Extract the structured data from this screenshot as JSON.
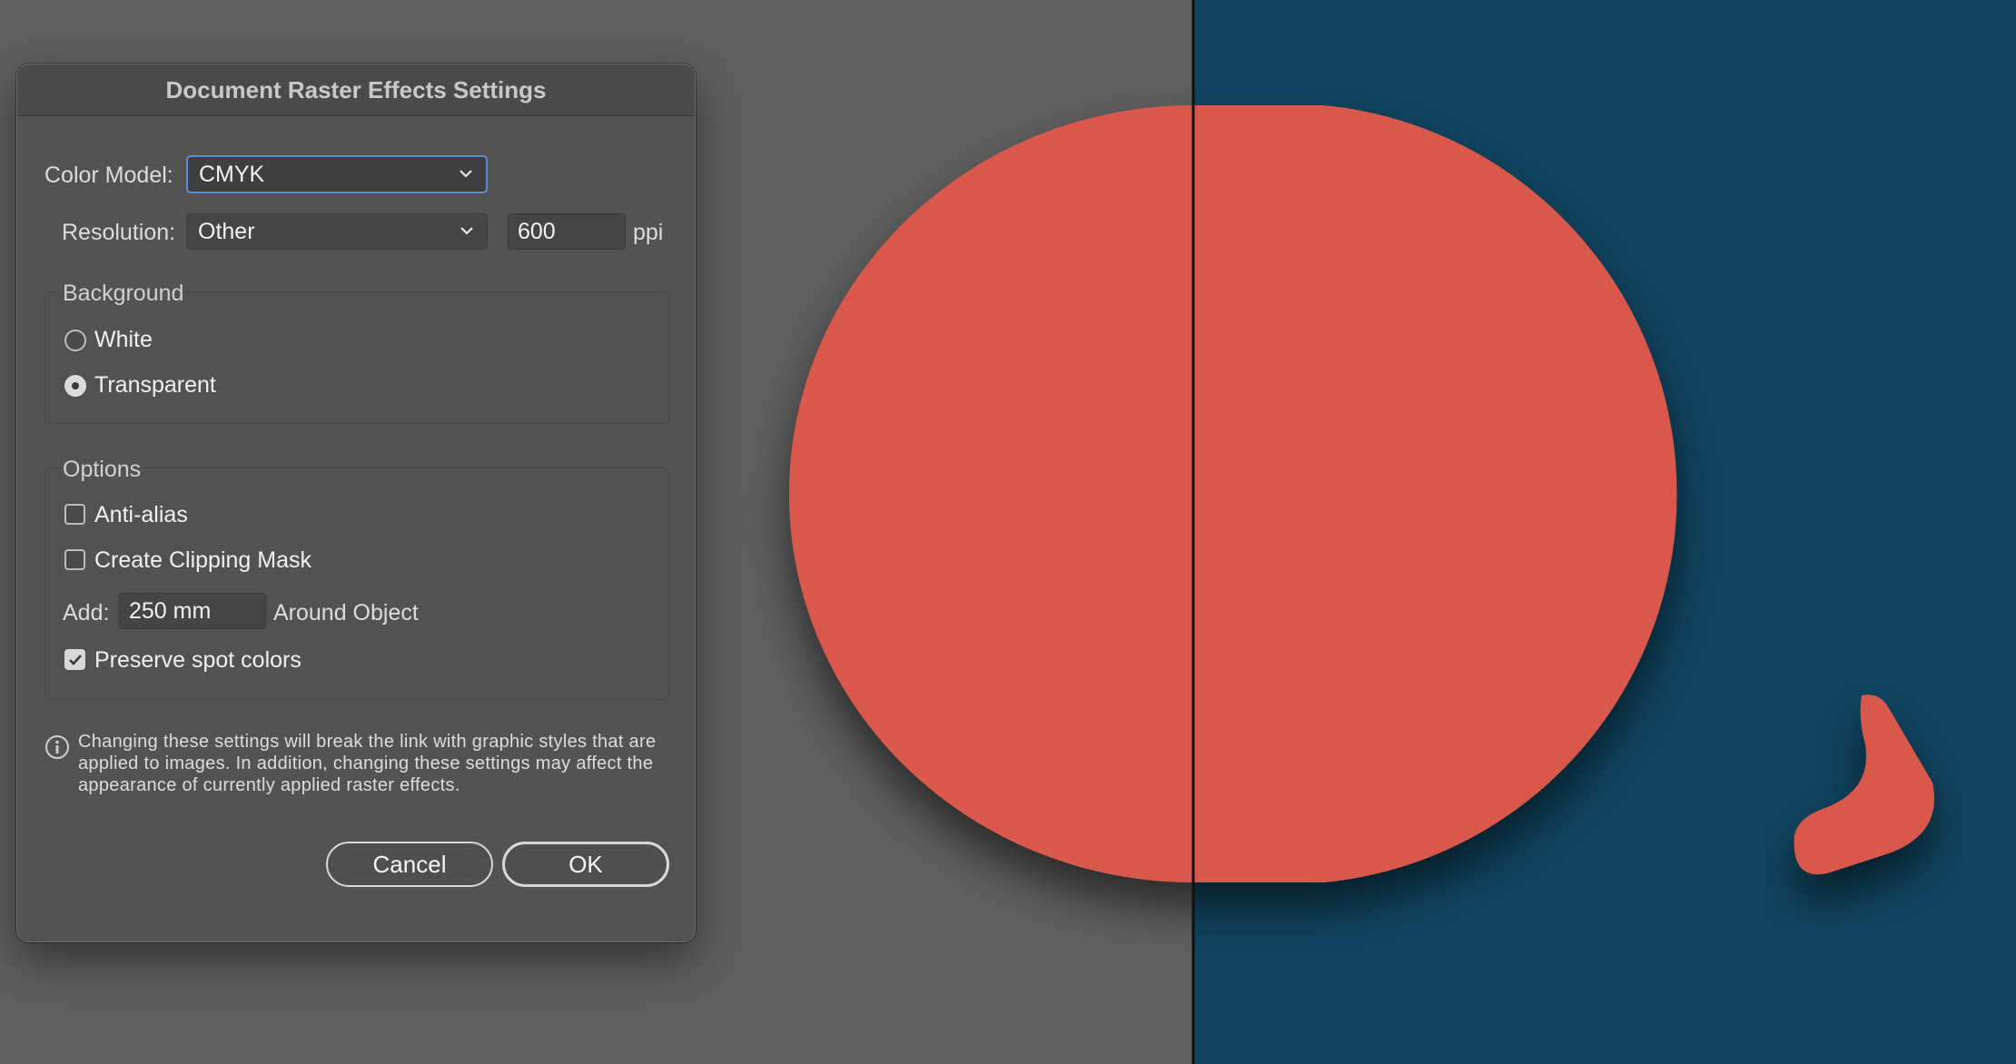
{
  "dialog": {
    "title": "Document Raster Effects Settings",
    "color_model": {
      "label": "Color Model:",
      "value": "CMYK"
    },
    "resolution": {
      "label": "Resolution:",
      "value": "Other",
      "ppi_value": "600",
      "unit": "ppi"
    },
    "background": {
      "title": "Background",
      "options": [
        {
          "label": "White",
          "selected": false
        },
        {
          "label": "Transparent",
          "selected": true
        }
      ]
    },
    "options": {
      "title": "Options",
      "anti_alias": {
        "label": "Anti-alias",
        "checked": false
      },
      "clipping_mask": {
        "label": "Create Clipping Mask",
        "checked": false
      },
      "add": {
        "label": "Add:",
        "value": "250 mm",
        "suffix": "Around Object"
      },
      "preserve_spot": {
        "label": "Preserve spot colors",
        "checked": true
      }
    },
    "info": "Changing these settings will break the link with graphic styles that are applied to images. In addition, changing these settings may affect the appearance of currently applied raster effects.",
    "cancel_label": "Cancel",
    "ok_label": "OK"
  },
  "colors": {
    "canvas_gray": "#5f5f5f",
    "artboard_blue": "#10445f",
    "shape_red": "#d8584b",
    "focus_blue": "#5b8ed6"
  }
}
